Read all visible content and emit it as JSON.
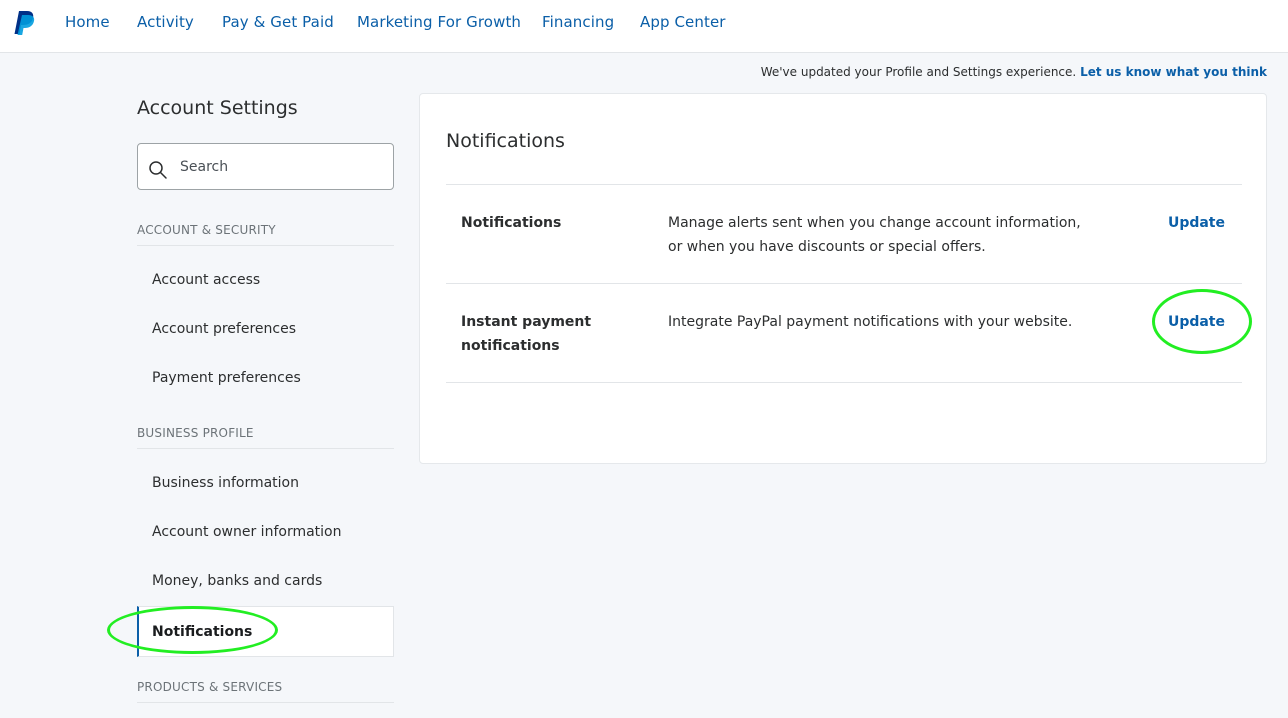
{
  "nav": {
    "items": [
      {
        "label": "Home"
      },
      {
        "label": "Activity"
      },
      {
        "label": "Pay & Get Paid"
      },
      {
        "label": "Marketing For Growth"
      },
      {
        "label": "Financing"
      },
      {
        "label": "App Center"
      }
    ]
  },
  "notice": {
    "text": "We've updated your Profile and Settings experience.",
    "link": "Let us know what you think"
  },
  "sidebar": {
    "title": "Account Settings",
    "search_placeholder": "Search",
    "sections": [
      {
        "label": "ACCOUNT & SECURITY",
        "items": [
          {
            "label": "Account access"
          },
          {
            "label": "Account preferences"
          },
          {
            "label": "Payment preferences"
          }
        ]
      },
      {
        "label": "BUSINESS PROFILE",
        "items": [
          {
            "label": "Business information"
          },
          {
            "label": "Account owner information"
          },
          {
            "label": "Money, banks and cards"
          },
          {
            "label": "Notifications",
            "active": true
          }
        ]
      },
      {
        "label": "PRODUCTS & SERVICES",
        "items": []
      }
    ]
  },
  "main": {
    "title": "Notifications",
    "rows": [
      {
        "label": "Notifications",
        "description": "Manage alerts sent when you change account information, or when you have discounts or special offers.",
        "action": "Update"
      },
      {
        "label": "Instant payment notifications",
        "description": "Integrate PayPal payment notifications with your website.",
        "action": "Update"
      }
    ]
  },
  "colors": {
    "link": "#0b5fa8",
    "annotation": "#22ee22",
    "background": "#f5f7fa"
  }
}
